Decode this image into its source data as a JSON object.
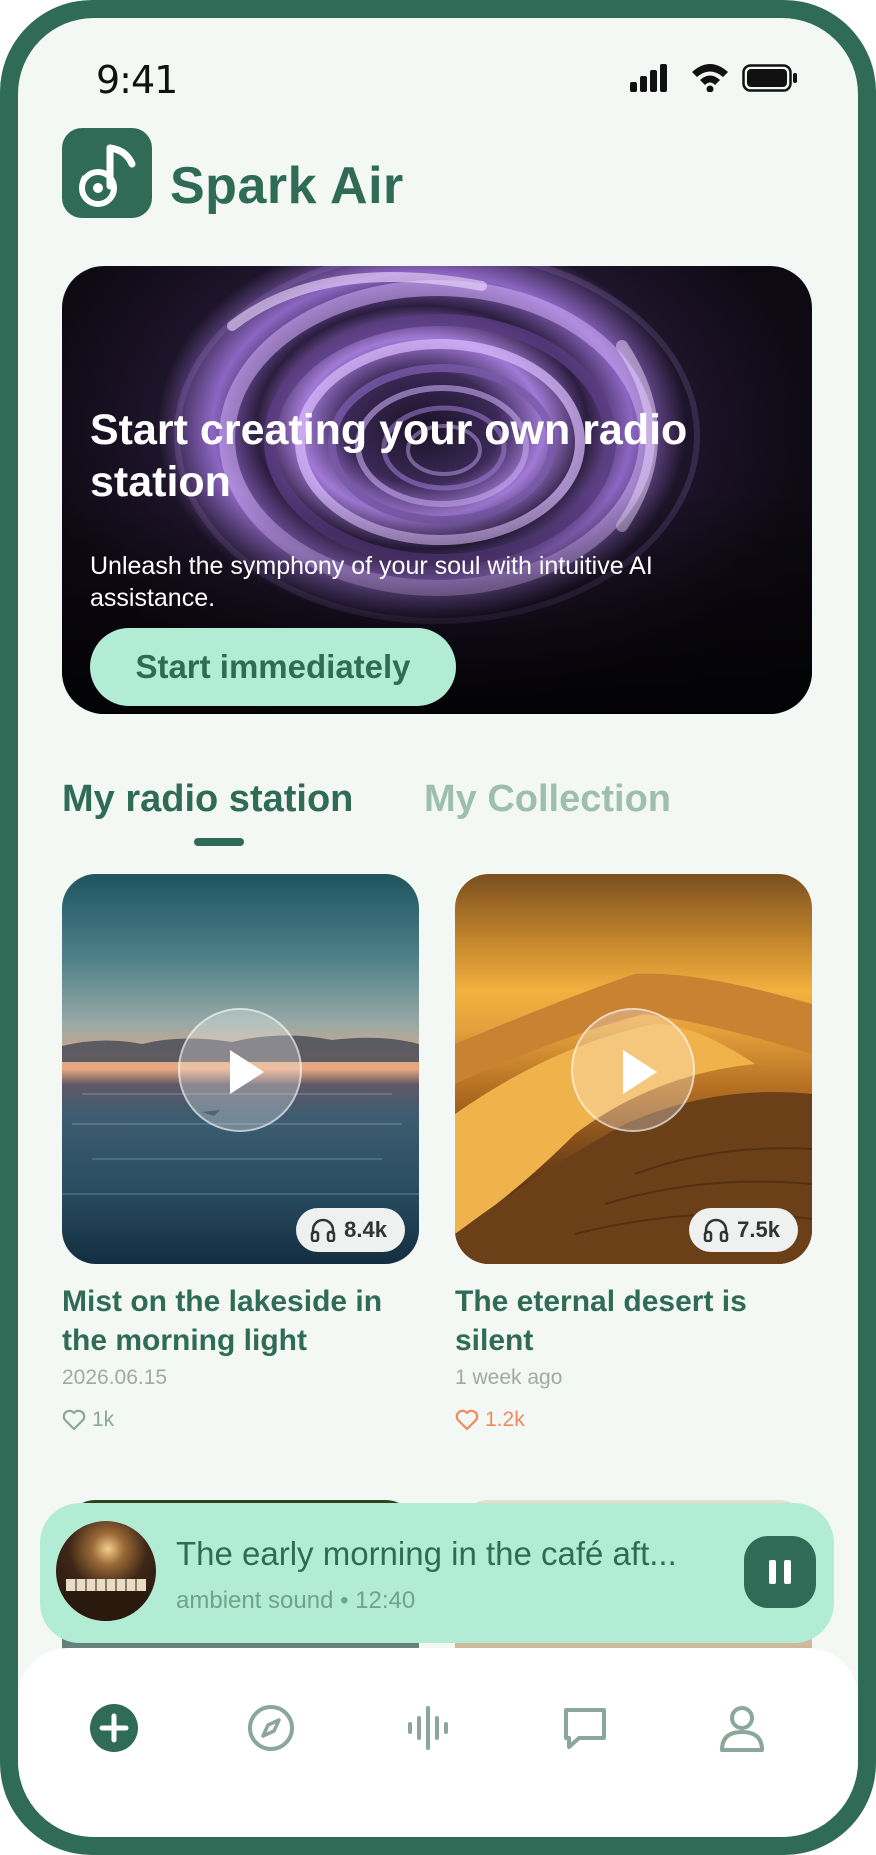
{
  "status_bar": {
    "time": "9:41"
  },
  "app": {
    "name": "Spark Air",
    "logo_icon": "music-note-icon"
  },
  "hero": {
    "title": "Start creating your own radio station",
    "subtitle": "Unleash the symphony of your soul with intuitive AI assistance.",
    "cta_label": "Start immediately"
  },
  "tabs": [
    {
      "label": "My radio station",
      "active": true
    },
    {
      "label": "My Collection",
      "active": false
    }
  ],
  "cards": [
    {
      "title": "Mist on the lakeside in the morning light",
      "date": "2026.06.15",
      "listens": "8.4k",
      "likes": "1k",
      "liked": false
    },
    {
      "title": "The eternal desert is silent",
      "date": "1 week ago",
      "listens": "7.5k",
      "likes": "1.2k",
      "liked": true
    }
  ],
  "player": {
    "title": "The early morning in the café aft...",
    "subtitle": "ambient sound • 12:40",
    "state": "playing"
  },
  "nav": [
    {
      "icon": "add-icon",
      "active": true
    },
    {
      "icon": "compass-icon",
      "active": false
    },
    {
      "icon": "waveform-icon",
      "active": false
    },
    {
      "icon": "chat-icon",
      "active": false
    },
    {
      "icon": "profile-icon",
      "active": false
    }
  ],
  "colors": {
    "brand": "#2f6b57",
    "mint": "#b2ecd5",
    "inactive_tab": "#9ebfaf",
    "liked": "#f08a5d",
    "background": "#f3f8f5"
  }
}
